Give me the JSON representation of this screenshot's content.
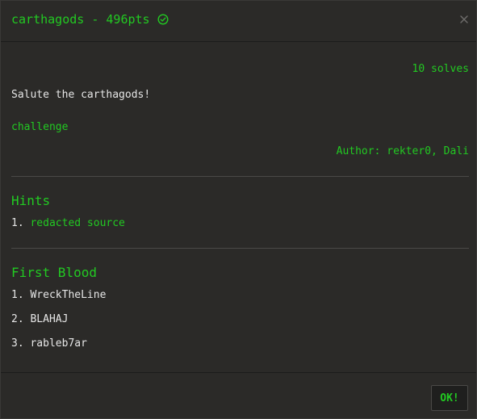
{
  "header": {
    "title": "carthagods - 496pts",
    "solved_icon": "check-circle-icon",
    "close_icon": "close-icon"
  },
  "challenge": {
    "solves": "10 solves",
    "description": "Salute the carthagods!",
    "link_label": "challenge",
    "author": "Author: rekter0, Dali"
  },
  "hints": {
    "title": "Hints",
    "items": [
      {
        "index": "1.",
        "label": "redacted source"
      }
    ]
  },
  "first_blood": {
    "title": "First Blood",
    "items": [
      {
        "index": "1.",
        "name": "WreckTheLine"
      },
      {
        "index": "2.",
        "name": "BLAHAJ"
      },
      {
        "index": "3.",
        "name": "rableb7ar"
      }
    ]
  },
  "footer": {
    "ok_label": "OK!"
  },
  "colors": {
    "accent": "#22c922",
    "background": "#2b2a28",
    "text": "#e6e6e6"
  }
}
